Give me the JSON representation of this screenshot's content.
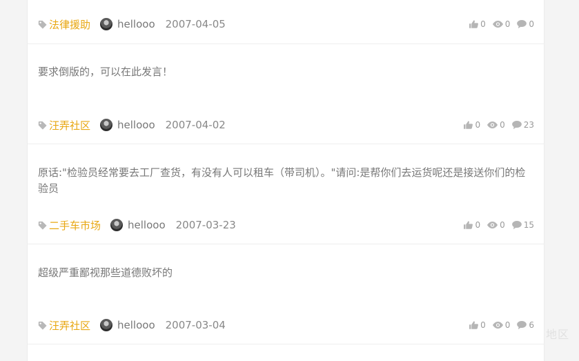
{
  "posts": [
    {
      "excerpt": "",
      "category": "法律援助",
      "author": "hellooo",
      "date": "2007-04-05",
      "likes": "0",
      "views": "0",
      "comments": "0"
    },
    {
      "excerpt": "要求倒版的，可以在此发言！",
      "category": "汪弄社区",
      "author": "hellooo",
      "date": "2007-04-02",
      "likes": "0",
      "views": "0",
      "comments": "23"
    },
    {
      "excerpt": "原话:\"检验员经常要去工厂查货，有没有人可以租车（带司机）。\"请问:是帮你们去运货呢还是接送你们的检验员",
      "category": "二手车市场",
      "author": "hellooo",
      "date": "2007-03-23",
      "likes": "0",
      "views": "0",
      "comments": "15"
    },
    {
      "excerpt": "超级严重鄙视那些道德败坏的",
      "category": "汪弄社区",
      "author": "hellooo",
      "date": "2007-03-04",
      "likes": "0",
      "views": "0",
      "comments": "6"
    }
  ],
  "watermark": "地区",
  "icons": {
    "tag": "tag-icon",
    "like": "thumbs-up-icon",
    "view": "eye-icon",
    "comment": "comment-icon"
  },
  "colors": {
    "category": "#e8a712",
    "text": "#777777",
    "meta": "#9a9a9a",
    "divider": "#eeeeee"
  }
}
